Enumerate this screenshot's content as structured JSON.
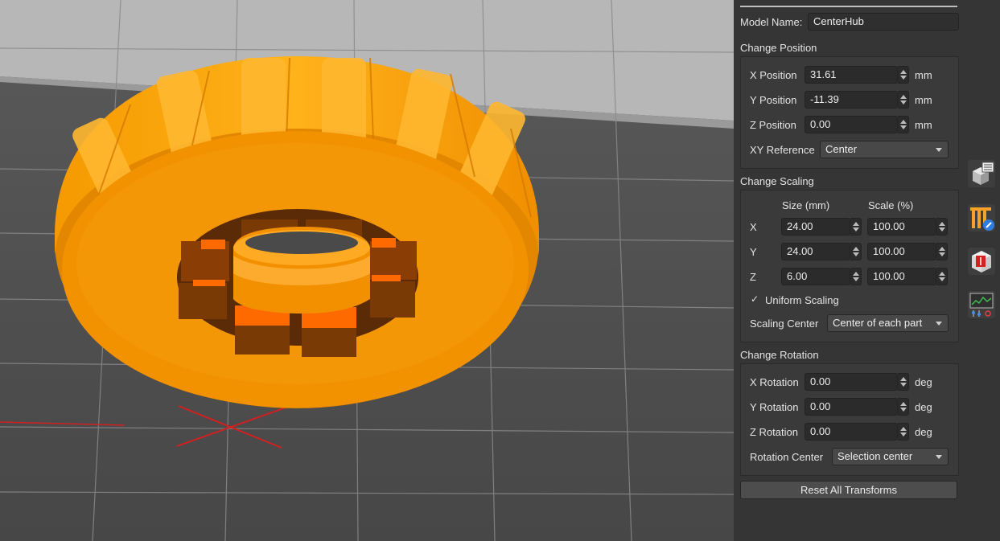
{
  "model": {
    "label": "Model Name:",
    "value": "CenterHub"
  },
  "position": {
    "title": "Change Position",
    "unit": "mm",
    "x": {
      "label": "X Position",
      "value": "31.61"
    },
    "y": {
      "label": "Y Position",
      "value": "-11.39"
    },
    "z": {
      "label": "Z Position",
      "value": "0.00"
    },
    "reference": {
      "label": "XY Reference",
      "value": "Center"
    }
  },
  "scaling": {
    "title": "Change Scaling",
    "size_header": "Size (mm)",
    "scale_header": "Scale (%)",
    "x": {
      "label": "X",
      "size": "24.00",
      "scale": "100.00"
    },
    "y": {
      "label": "Y",
      "size": "24.00",
      "scale": "100.00"
    },
    "z": {
      "label": "Z",
      "size": "6.00",
      "scale": "100.00"
    },
    "uniform": {
      "label": "Uniform Scaling",
      "checked": true,
      "mark": "✓"
    },
    "center": {
      "label": "Scaling Center",
      "value": "Center of each part"
    }
  },
  "rotation": {
    "title": "Change Rotation",
    "unit": "deg",
    "x": {
      "label": "X Rotation",
      "value": "0.00"
    },
    "y": {
      "label": "Y Rotation",
      "value": "0.00"
    },
    "z": {
      "label": "Z Rotation",
      "value": "0.00"
    },
    "center": {
      "label": "Rotation Center",
      "value": "Selection center"
    }
  },
  "reset_button": "Reset All Transforms",
  "toolbar_icons": [
    "object-settings-icon",
    "support-paint-icon",
    "seam-cube-icon",
    "layer-chart-icon"
  ],
  "colors": {
    "model": "#ffa500",
    "panel": "#353535",
    "viewport": "#4a4a4a",
    "axis": "#d02020"
  }
}
